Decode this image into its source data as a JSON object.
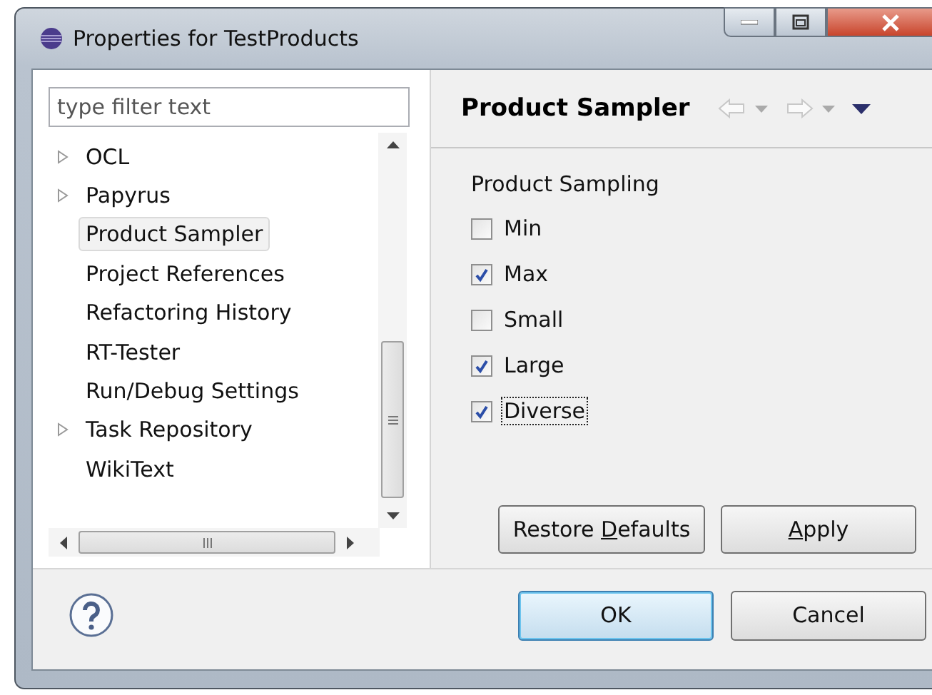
{
  "window": {
    "title": "Properties for TestProducts"
  },
  "filter": {
    "placeholder": "type filter text"
  },
  "tree": [
    {
      "label": "OCL",
      "expandable": true,
      "selected": false
    },
    {
      "label": "Papyrus",
      "expandable": true,
      "selected": false
    },
    {
      "label": "Product Sampler",
      "expandable": false,
      "selected": true
    },
    {
      "label": "Project References",
      "expandable": false,
      "selected": false
    },
    {
      "label": "Refactoring History",
      "expandable": false,
      "selected": false
    },
    {
      "label": "RT-Tester",
      "expandable": false,
      "selected": false
    },
    {
      "label": "Run/Debug Settings",
      "expandable": false,
      "selected": false
    },
    {
      "label": "Task Repository",
      "expandable": true,
      "selected": false
    },
    {
      "label": "WikiText",
      "expandable": false,
      "selected": false
    }
  ],
  "page": {
    "title": "Product Sampler",
    "group_label": "Product Sampling",
    "options": [
      {
        "label": "Min",
        "checked": false,
        "focused": false
      },
      {
        "label": "Max",
        "checked": true,
        "focused": false
      },
      {
        "label": "Small",
        "checked": false,
        "focused": false
      },
      {
        "label": "Large",
        "checked": true,
        "focused": false
      },
      {
        "label": "Diverse",
        "checked": true,
        "focused": true
      }
    ],
    "buttons": [
      {
        "label_before": "Restore ",
        "access_key": "D",
        "label_after": "efaults"
      },
      {
        "access_key": "A",
        "label_after": "pply"
      }
    ]
  },
  "footer": {
    "buttons": [
      {
        "label": "OK",
        "default": true
      },
      {
        "label": "Cancel",
        "default": false
      }
    ]
  }
}
